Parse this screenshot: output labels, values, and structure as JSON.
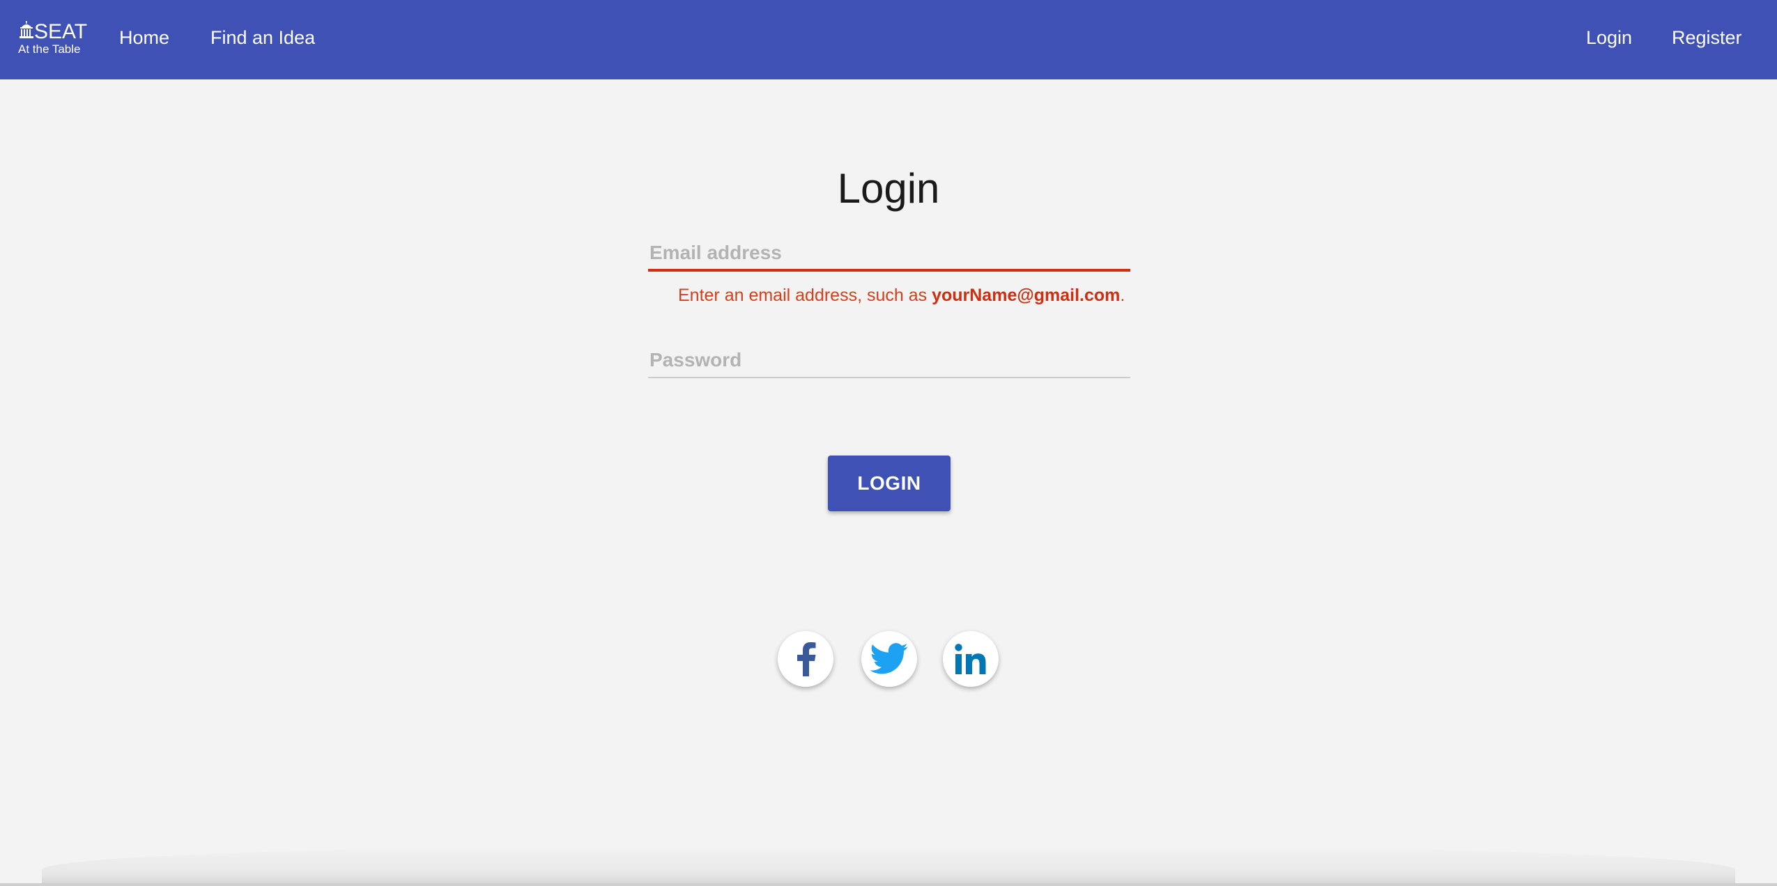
{
  "header": {
    "logo": {
      "title": "SEAT",
      "subtitle": "At the Table",
      "icon": "capitol-building-icon"
    },
    "nav_left": [
      {
        "label": "Home"
      },
      {
        "label": "Find an Idea"
      }
    ],
    "nav_right": [
      {
        "label": "Login"
      },
      {
        "label": "Register"
      }
    ]
  },
  "login_form": {
    "title": "Login",
    "email": {
      "placeholder": "Email address",
      "value": ""
    },
    "email_error": {
      "prefix": "Enter an email address, such as ",
      "example": "yourName@gmail.com",
      "suffix": "."
    },
    "password": {
      "placeholder": "Password",
      "value": ""
    },
    "submit_label": "LOGIN"
  },
  "social_buttons": [
    {
      "icon": "facebook-icon",
      "color": "#3b5998"
    },
    {
      "icon": "twitter-icon",
      "color": "#1da1f2"
    },
    {
      "icon": "linkedin-icon",
      "color": "#0077b5"
    }
  ],
  "colors": {
    "primary": "#3f51b5",
    "error": "#d32f0f",
    "background": "#f3f3f3"
  }
}
